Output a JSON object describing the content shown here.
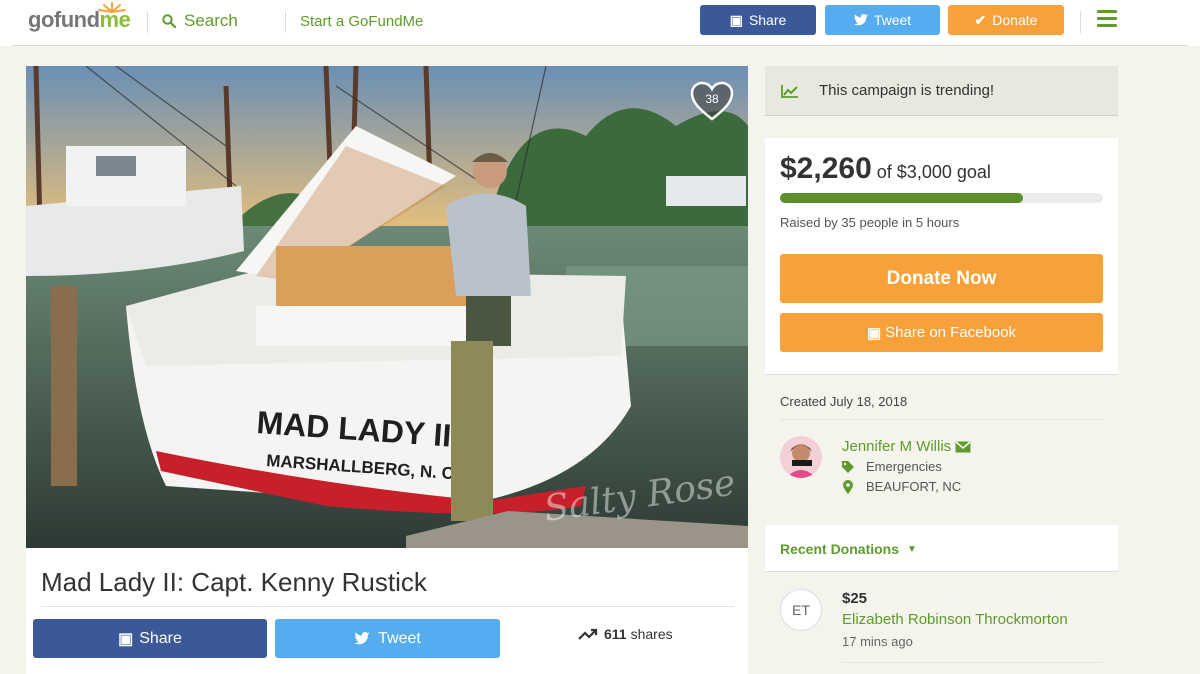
{
  "header": {
    "logo_go": "gofund",
    "logo_me": "me",
    "search_label": "Search",
    "start_label": "Start a GoFundMe",
    "share_label": "Share",
    "tweet_label": "Tweet",
    "donate_label": "Donate",
    "menu_icon": "hamburger-icon"
  },
  "hero": {
    "boat_name": "MAD LADY II",
    "boat_home": "MARSHALLBERG, N. C.",
    "watermark": "Salty Rose",
    "heart_count": "38"
  },
  "campaign": {
    "title": "Mad Lady II: Capt. Kenny Rustick",
    "share_label": "Share",
    "tweet_label": "Tweet",
    "shares_count": "611",
    "shares_word": "shares"
  },
  "sidebar": {
    "trending_text": "This campaign is trending!",
    "raised_amount": "$2,260",
    "goal_text": "of $3,000 goal",
    "progress_fraction": 0.753,
    "raised_by": "Raised by 35 people in 5 hours",
    "donate_now_label": "Donate Now",
    "share_facebook_label": "Share on Facebook",
    "created": "Created July 18, 2018",
    "organizer_name": "Jennifer M Willis",
    "category": "Emergencies",
    "location": "BEAUFORT, NC",
    "recent_label": "Recent Donations",
    "donation": {
      "initials": "ET",
      "amount": "$25",
      "name": "Elizabeth Robinson Throckmorton",
      "time": "17 mins ago"
    }
  },
  "colors": {
    "brand_green": "#5f9a2d",
    "facebook_blue": "#3b5998",
    "twitter_blue": "#55acee",
    "donate_orange": "#f8a13a",
    "progress_green": "#5a8f29"
  }
}
